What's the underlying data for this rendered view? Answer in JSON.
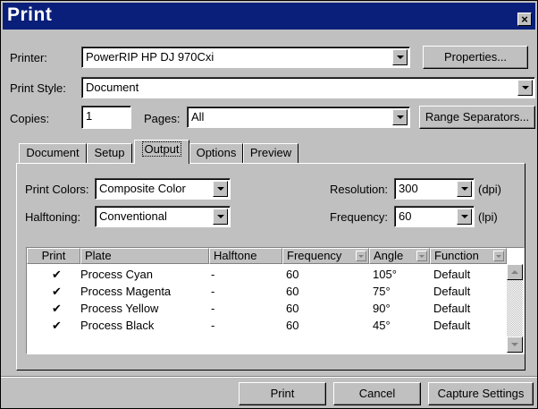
{
  "window": {
    "title": "Print",
    "close_glyph": "×"
  },
  "printer": {
    "label": "Printer:",
    "value": "PowerRIP HP DJ 970Cxi",
    "properties_button": "Properties..."
  },
  "print_style": {
    "label": "Print Style:",
    "value": "Document"
  },
  "copies": {
    "label": "Copies:",
    "value": "1"
  },
  "pages": {
    "label": "Pages:",
    "value": "All",
    "range_button": "Range Separators..."
  },
  "tabs": [
    {
      "label": "Document",
      "active": false
    },
    {
      "label": "Setup",
      "active": false
    },
    {
      "label": "Output",
      "active": true
    },
    {
      "label": "Options",
      "active": false
    },
    {
      "label": "Preview",
      "active": false
    }
  ],
  "output": {
    "print_colors": {
      "label": "Print Colors:",
      "value": "Composite Color"
    },
    "halftoning": {
      "label": "Halftoning:",
      "value": "Conventional"
    },
    "resolution": {
      "label": "Resolution:",
      "value": "300",
      "unit": "(dpi)"
    },
    "frequency": {
      "label": "Frequency:",
      "value": "60",
      "unit": "(lpi)"
    }
  },
  "plates_table": {
    "columns": [
      "Print",
      "Plate",
      "Halftone",
      "Frequency",
      "Angle",
      "Function"
    ],
    "rows": [
      {
        "print": "✔",
        "plate": "Process Cyan",
        "halftone": "-",
        "frequency": "60",
        "angle": "105°",
        "function": "Default"
      },
      {
        "print": "✔",
        "plate": "Process Magenta",
        "halftone": "-",
        "frequency": "60",
        "angle": "75°",
        "function": "Default"
      },
      {
        "print": "✔",
        "plate": "Process Yellow",
        "halftone": "-",
        "frequency": "60",
        "angle": "90°",
        "function": "Default"
      },
      {
        "print": "✔",
        "plate": "Process Black",
        "halftone": "-",
        "frequency": "60",
        "angle": "45°",
        "function": "Default"
      }
    ]
  },
  "footer": {
    "print_button": "Print",
    "cancel_button": "Cancel",
    "capture_button": "Capture Settings"
  },
  "colors": {
    "titlebar": "#0a1f7a",
    "face": "#c0c0c0"
  }
}
